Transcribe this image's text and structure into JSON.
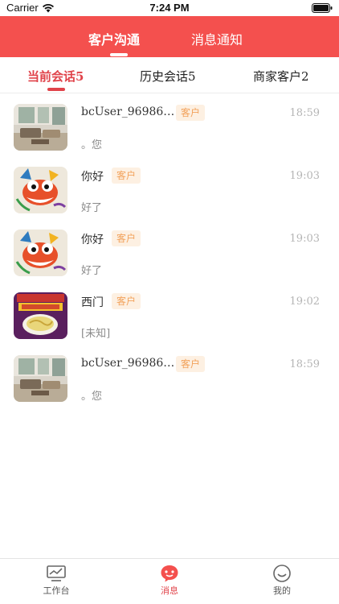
{
  "status_bar": {
    "carrier": "Carrier",
    "time": "7:24 PM"
  },
  "top_tabs": [
    {
      "label": "客户沟通",
      "active": true
    },
    {
      "label": "消息通知",
      "active": false
    }
  ],
  "sub_tabs": [
    {
      "label": "当前会话5",
      "active": true
    },
    {
      "label": "历史会话5",
      "active": false
    },
    {
      "label": "商家客户2",
      "active": false
    }
  ],
  "conversations": [
    {
      "name": "bcUser_96986…",
      "badge": "客户",
      "time": "18:59",
      "preview": "。您",
      "avatar": "room-photo"
    },
    {
      "name": "你好",
      "badge": "客户",
      "time": "19:03",
      "preview": "好了",
      "avatar": "dragon-art"
    },
    {
      "name": "你好",
      "badge": "客户",
      "time": "19:03",
      "preview": "好了",
      "avatar": "dragon-art"
    },
    {
      "name": "西门",
      "badge": "客户",
      "time": "19:02",
      "preview": "[未知]",
      "avatar": "food-package"
    },
    {
      "name": "bcUser_96986…",
      "badge": "客户",
      "time": "18:59",
      "preview": "。您",
      "avatar": "room-photo"
    }
  ],
  "bottom_nav": [
    {
      "label": "工作台",
      "icon": "monitor-icon",
      "active": false
    },
    {
      "label": "消息",
      "icon": "chat-icon",
      "active": true
    },
    {
      "label": "我的",
      "icon": "profile-icon",
      "active": false
    }
  ],
  "colors": {
    "brand_red": "#f4504e",
    "accent_red": "#e0434a",
    "badge_text": "#f2a25b",
    "badge_bg": "#fdf0e2"
  }
}
